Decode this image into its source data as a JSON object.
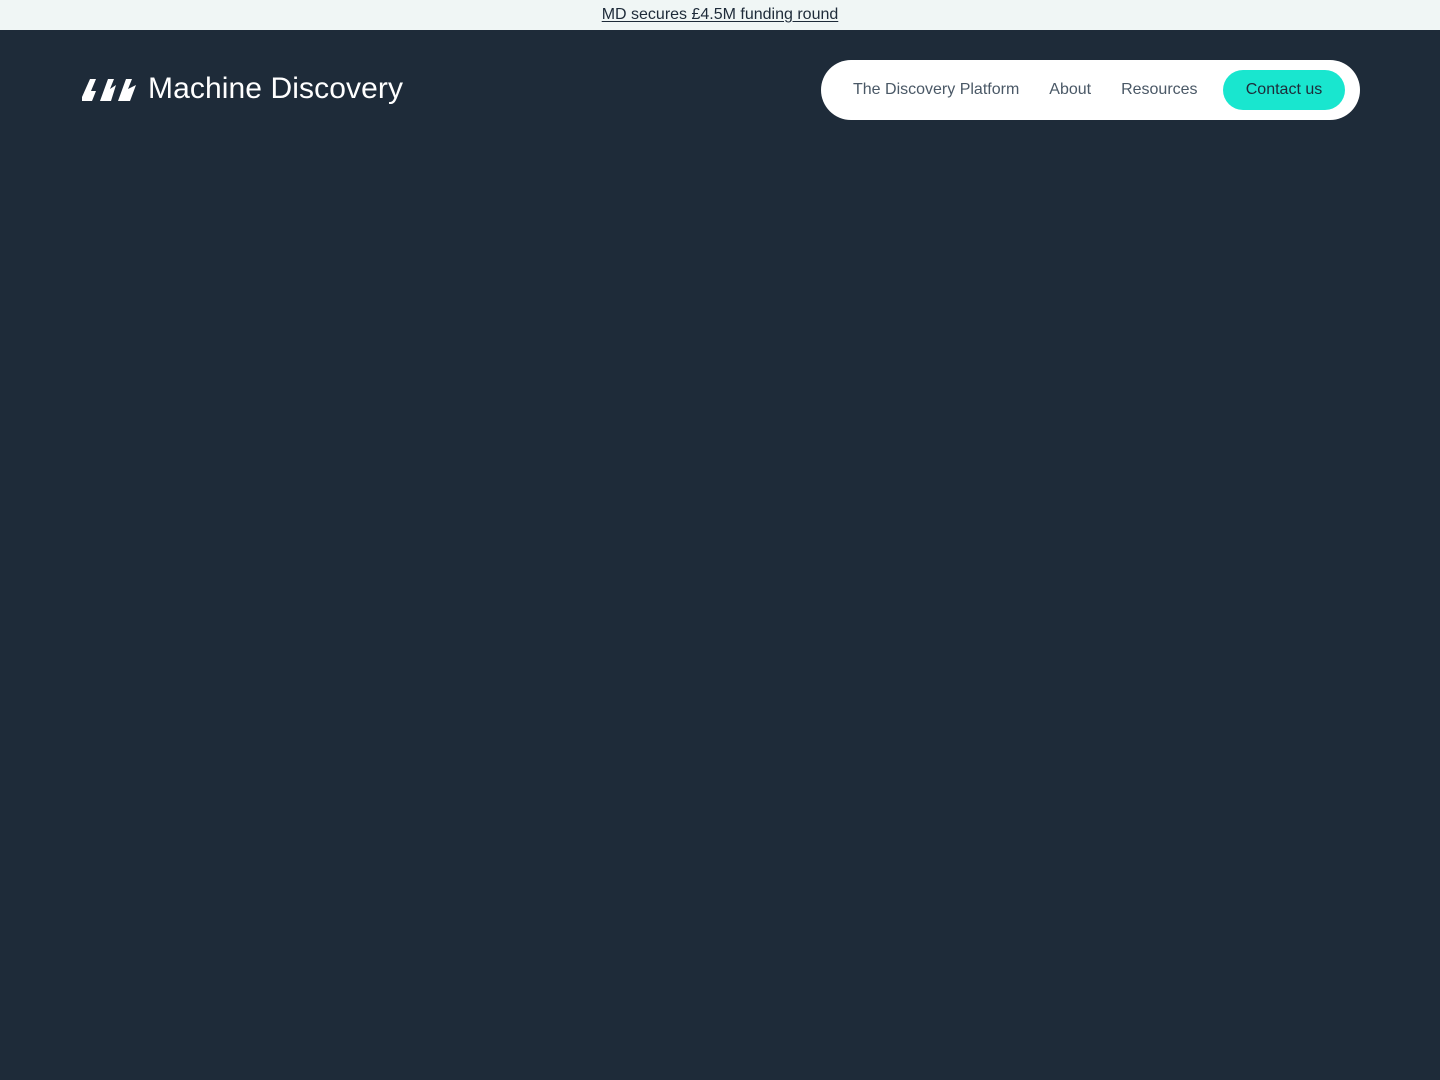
{
  "announcement": {
    "text": "MD secures £4.5M funding round"
  },
  "brand": {
    "name": "Machine Discovery",
    "logo_icon": "three-slanted-bars-logo-icon"
  },
  "nav": {
    "items": [
      {
        "label": "The Discovery Platform"
      },
      {
        "label": "About"
      },
      {
        "label": "Resources"
      }
    ],
    "cta_label": "Contact us"
  },
  "colors": {
    "background": "#1e2b39",
    "announcement_bg": "#f0f6f5",
    "accent": "#19e6cf",
    "nav_text": "#4a5866"
  }
}
